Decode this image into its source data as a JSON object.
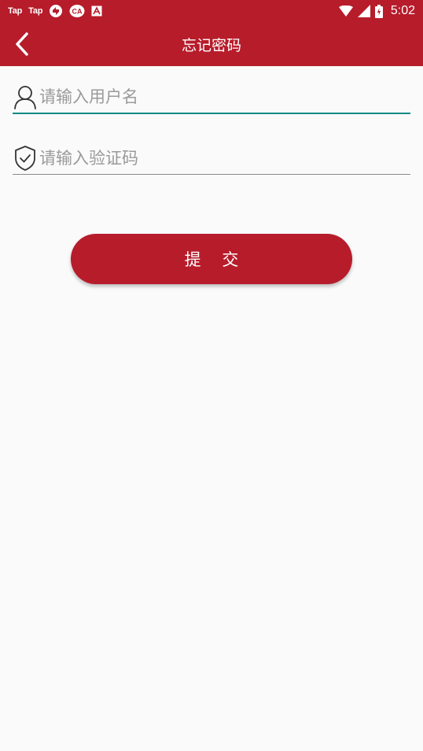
{
  "status_bar": {
    "app_label_1": "Tap",
    "app_label_2": "Tap",
    "time": "5:02",
    "icons": [
      "taptap-icon",
      "taptap-icon",
      "sync-icon",
      "ca-icon",
      "a-box-icon",
      "wifi-icon",
      "signal-icon",
      "battery-icon"
    ]
  },
  "app_bar": {
    "title": "忘记密码",
    "back_icon": "chevron-left-icon"
  },
  "form": {
    "username": {
      "placeholder": "请输入用户名",
      "value": "",
      "icon": "user-icon"
    },
    "code": {
      "placeholder": "请输入验证码",
      "value": "",
      "icon": "shield-check-icon"
    },
    "submit_label": "提 交"
  },
  "colors": {
    "primary": "#b71c2b",
    "active_underline": "#0b8a84",
    "background": "#fafafa"
  }
}
